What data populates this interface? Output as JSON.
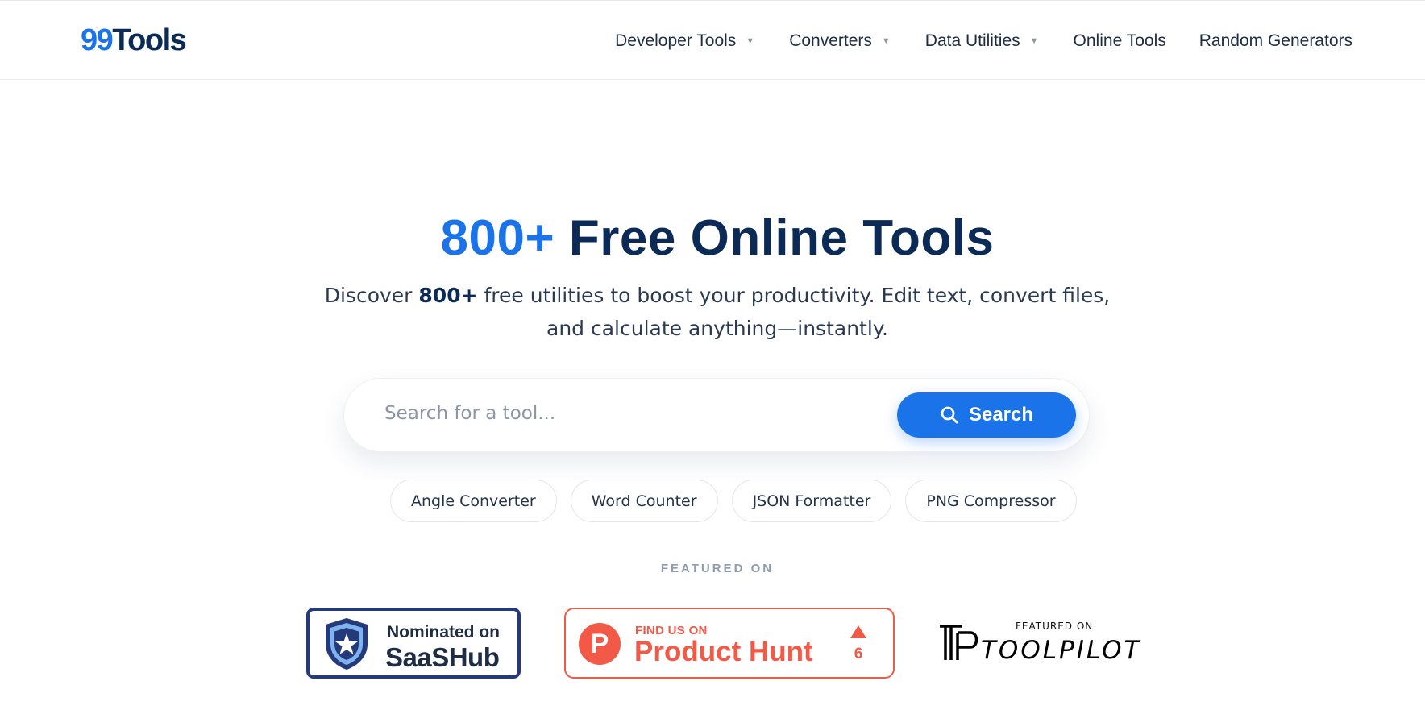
{
  "header": {
    "logo": {
      "number": "99",
      "word": "Tools"
    },
    "nav": [
      {
        "label": "Developer Tools",
        "has_dropdown": true
      },
      {
        "label": "Converters",
        "has_dropdown": true
      },
      {
        "label": "Data Utilities",
        "has_dropdown": true
      },
      {
        "label": "Online Tools",
        "has_dropdown": false
      },
      {
        "label": "Random Generators",
        "has_dropdown": false
      }
    ],
    "caret_icon": "caret-down-icon"
  },
  "hero": {
    "title_accent": "800+",
    "title_rest": "Free Online Tools",
    "subtitle_pre": "Discover",
    "subtitle_bold": "800+",
    "subtitle_post": "free utilities to boost your productivity. Edit text, convert files,",
    "subtitle_line2": "and calculate anything—instantly."
  },
  "search": {
    "placeholder": "Search for a tool...",
    "value": "",
    "button_label": "Search",
    "button_icon": "search-icon"
  },
  "popular_tools": [
    "Angle Converter",
    "Word Counter",
    "JSON Formatter",
    "PNG Compressor"
  ],
  "featured": {
    "label": "FEATURED ON",
    "saashub": {
      "top": "Nominated on",
      "main": "SaaSHub"
    },
    "producthunt": {
      "logo_letter": "P",
      "top": "FIND US ON",
      "main": "Product Hunt",
      "upvotes": "6"
    },
    "toolpilot": {
      "top": "FEATURED ON",
      "main": "TOOLPILOT"
    }
  },
  "colors": {
    "brand_blue": "#1a73e8",
    "navy": "#0b2a55",
    "producthunt_red": "#f25a47",
    "saashub_navy": "#243a7a"
  }
}
